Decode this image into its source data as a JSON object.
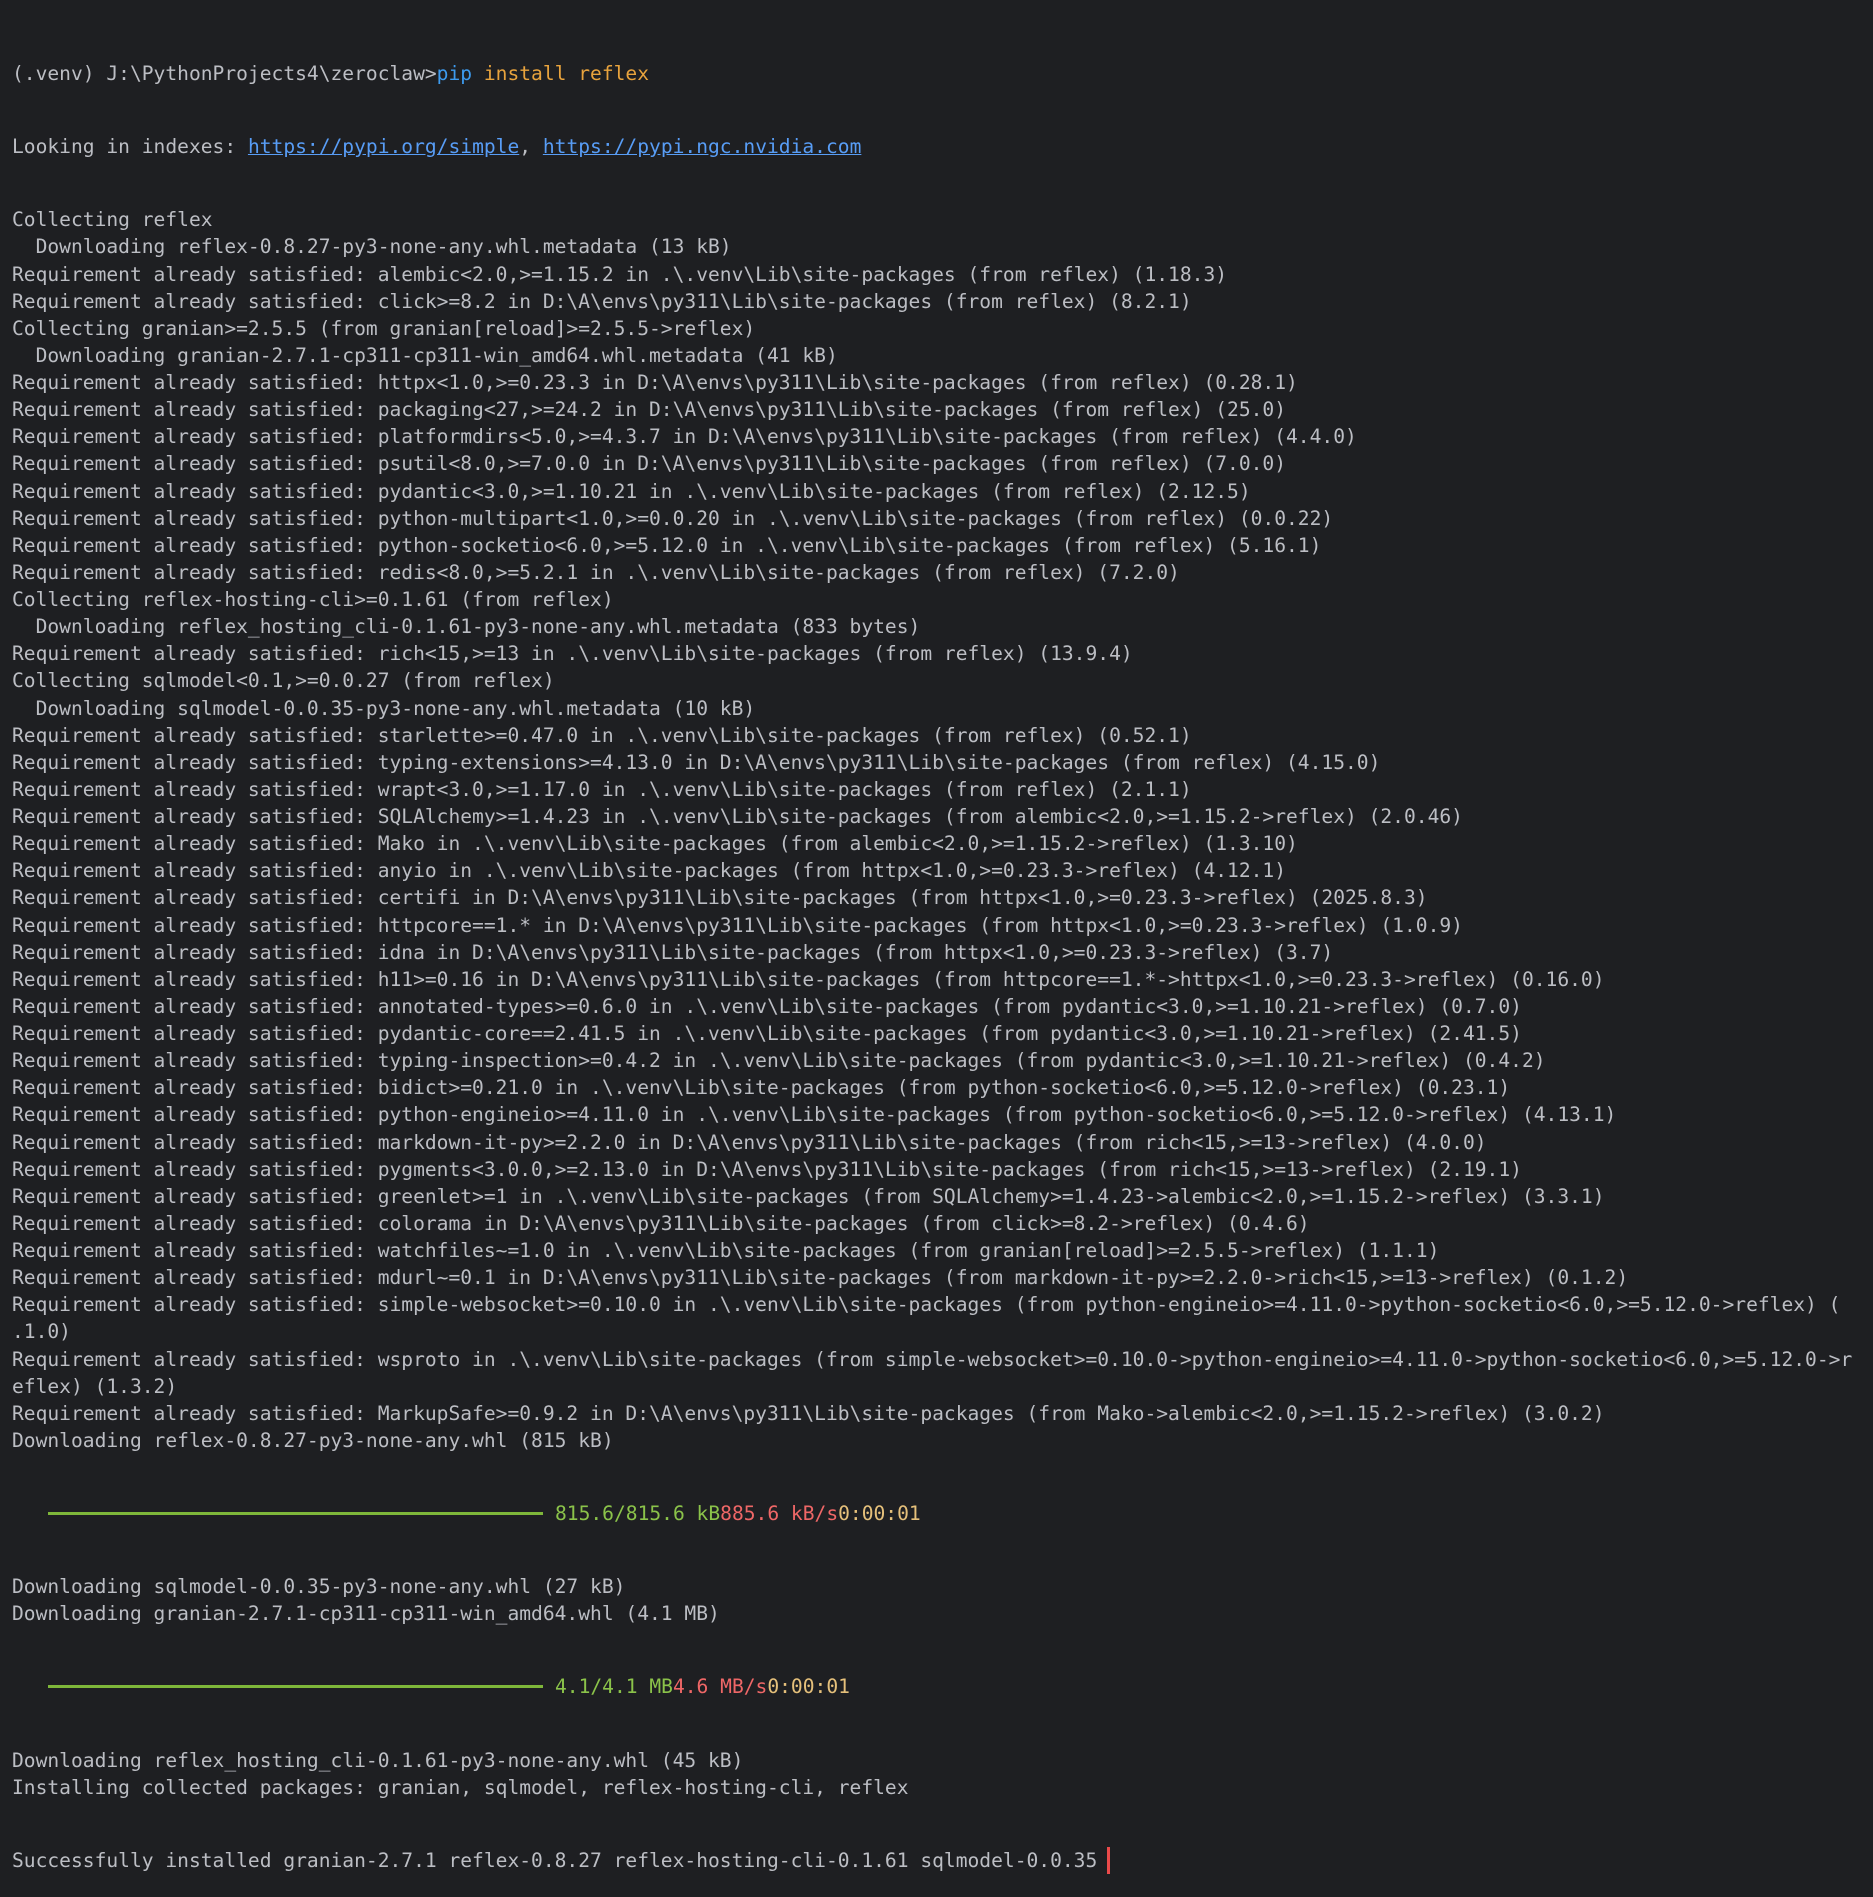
{
  "theme": {
    "background": "#1e1f22",
    "text": "#bcbec4",
    "command_keyword": "#3d9bef",
    "command_arg": "#e8a33d",
    "link": "#589df6",
    "progress_bar": "#7eb63a",
    "progress_size": "#8bc34a",
    "progress_speed": "#ef6767",
    "progress_eta": "#e5c07b",
    "highlight_border": "#ea4a4a"
  },
  "prompt": {
    "path": "(.venv) J:\\PythonProjects4\\zeroclaw>",
    "cmd": "pip",
    "args": " install reflex"
  },
  "indexes": {
    "label": "Looking in indexes: ",
    "link1": "https://pypi.org/simple",
    "sep": ", ",
    "link2": "https://pypi.ngc.nvidia.com"
  },
  "lines_a": [
    "Collecting reflex",
    "  Downloading reflex-0.8.27-py3-none-any.whl.metadata (13 kB)",
    "Requirement already satisfied: alembic<2.0,>=1.15.2 in .\\.venv\\Lib\\site-packages (from reflex) (1.18.3)",
    "Requirement already satisfied: click>=8.2 in D:\\A\\envs\\py311\\Lib\\site-packages (from reflex) (8.2.1)",
    "Collecting granian>=2.5.5 (from granian[reload]>=2.5.5->reflex)",
    "  Downloading granian-2.7.1-cp311-cp311-win_amd64.whl.metadata (41 kB)",
    "Requirement already satisfied: httpx<1.0,>=0.23.3 in D:\\A\\envs\\py311\\Lib\\site-packages (from reflex) (0.28.1)",
    "Requirement already satisfied: packaging<27,>=24.2 in D:\\A\\envs\\py311\\Lib\\site-packages (from reflex) (25.0)",
    "Requirement already satisfied: platformdirs<5.0,>=4.3.7 in D:\\A\\envs\\py311\\Lib\\site-packages (from reflex) (4.4.0)",
    "Requirement already satisfied: psutil<8.0,>=7.0.0 in D:\\A\\envs\\py311\\Lib\\site-packages (from reflex) (7.0.0)",
    "Requirement already satisfied: pydantic<3.0,>=1.10.21 in .\\.venv\\Lib\\site-packages (from reflex) (2.12.5)",
    "Requirement already satisfied: python-multipart<1.0,>=0.0.20 in .\\.venv\\Lib\\site-packages (from reflex) (0.0.22)",
    "Requirement already satisfied: python-socketio<6.0,>=5.12.0 in .\\.venv\\Lib\\site-packages (from reflex) (5.16.1)",
    "Requirement already satisfied: redis<8.0,>=5.2.1 in .\\.venv\\Lib\\site-packages (from reflex) (7.2.0)",
    "Collecting reflex-hosting-cli>=0.1.61 (from reflex)",
    "  Downloading reflex_hosting_cli-0.1.61-py3-none-any.whl.metadata (833 bytes)",
    "Requirement already satisfied: rich<15,>=13 in .\\.venv\\Lib\\site-packages (from reflex) (13.9.4)",
    "Collecting sqlmodel<0.1,>=0.0.27 (from reflex)",
    "  Downloading sqlmodel-0.0.35-py3-none-any.whl.metadata (10 kB)",
    "Requirement already satisfied: starlette>=0.47.0 in .\\.venv\\Lib\\site-packages (from reflex) (0.52.1)",
    "Requirement already satisfied: typing-extensions>=4.13.0 in D:\\A\\envs\\py311\\Lib\\site-packages (from reflex) (4.15.0)",
    "Requirement already satisfied: wrapt<3.0,>=1.17.0 in .\\.venv\\Lib\\site-packages (from reflex) (2.1.1)",
    "Requirement already satisfied: SQLAlchemy>=1.4.23 in .\\.venv\\Lib\\site-packages (from alembic<2.0,>=1.15.2->reflex) (2.0.46)",
    "Requirement already satisfied: Mako in .\\.venv\\Lib\\site-packages (from alembic<2.0,>=1.15.2->reflex) (1.3.10)",
    "Requirement already satisfied: anyio in .\\.venv\\Lib\\site-packages (from httpx<1.0,>=0.23.3->reflex) (4.12.1)",
    "Requirement already satisfied: certifi in D:\\A\\envs\\py311\\Lib\\site-packages (from httpx<1.0,>=0.23.3->reflex) (2025.8.3)",
    "Requirement already satisfied: httpcore==1.* in D:\\A\\envs\\py311\\Lib\\site-packages (from httpx<1.0,>=0.23.3->reflex) (1.0.9)",
    "Requirement already satisfied: idna in D:\\A\\envs\\py311\\Lib\\site-packages (from httpx<1.0,>=0.23.3->reflex) (3.7)",
    "Requirement already satisfied: h11>=0.16 in D:\\A\\envs\\py311\\Lib\\site-packages (from httpcore==1.*->httpx<1.0,>=0.23.3->reflex) (0.16.0)",
    "Requirement already satisfied: annotated-types>=0.6.0 in .\\.venv\\Lib\\site-packages (from pydantic<3.0,>=1.10.21->reflex) (0.7.0)",
    "Requirement already satisfied: pydantic-core==2.41.5 in .\\.venv\\Lib\\site-packages (from pydantic<3.0,>=1.10.21->reflex) (2.41.5)",
    "Requirement already satisfied: typing-inspection>=0.4.2 in .\\.venv\\Lib\\site-packages (from pydantic<3.0,>=1.10.21->reflex) (0.4.2)",
    "Requirement already satisfied: bidict>=0.21.0 in .\\.venv\\Lib\\site-packages (from python-socketio<6.0,>=5.12.0->reflex) (0.23.1)",
    "Requirement already satisfied: python-engineio>=4.11.0 in .\\.venv\\Lib\\site-packages (from python-socketio<6.0,>=5.12.0->reflex) (4.13.1)",
    "Requirement already satisfied: markdown-it-py>=2.2.0 in D:\\A\\envs\\py311\\Lib\\site-packages (from rich<15,>=13->reflex) (4.0.0)",
    "Requirement already satisfied: pygments<3.0.0,>=2.13.0 in D:\\A\\envs\\py311\\Lib\\site-packages (from rich<15,>=13->reflex) (2.19.1)",
    "Requirement already satisfied: greenlet>=1 in .\\.venv\\Lib\\site-packages (from SQLAlchemy>=1.4.23->alembic<2.0,>=1.15.2->reflex) (3.3.1)",
    "Requirement already satisfied: colorama in D:\\A\\envs\\py311\\Lib\\site-packages (from click>=8.2->reflex) (0.4.6)",
    "Requirement already satisfied: watchfiles~=1.0 in .\\.venv\\Lib\\site-packages (from granian[reload]>=2.5.5->reflex) (1.1.1)",
    "Requirement already satisfied: mdurl~=0.1 in D:\\A\\envs\\py311\\Lib\\site-packages (from markdown-it-py>=2.2.0->rich<15,>=13->reflex) (0.1.2)",
    "Requirement already satisfied: simple-websocket>=0.10.0 in .\\.venv\\Lib\\site-packages (from python-engineio>=4.11.0->python-socketio<6.0,>=5.12.0->reflex) (",
    ".1.0)",
    "Requirement already satisfied: wsproto in .\\.venv\\Lib\\site-packages (from simple-websocket>=0.10.0->python-engineio>=4.11.0->python-socketio<6.0,>=5.12.0->r",
    "eflex) (1.3.2)",
    "Requirement already satisfied: MarkupSafe>=0.9.2 in D:\\A\\envs\\py311\\Lib\\site-packages (from Mako->alembic<2.0,>=1.15.2->reflex) (3.0.2)",
    "Downloading reflex-0.8.27-py3-none-any.whl (815 kB)"
  ],
  "progress1": {
    "fraction": 1.0,
    "size": "815.6/815.6 kB",
    "speed": "885.6 kB/s",
    "eta": "0:00:01"
  },
  "lines_b": [
    "Downloading sqlmodel-0.0.35-py3-none-any.whl (27 kB)",
    "Downloading granian-2.7.1-cp311-cp311-win_amd64.whl (4.1 MB)"
  ],
  "progress2": {
    "fraction": 1.0,
    "size": "4.1/4.1 MB",
    "speed": "4.6 MB/s",
    "eta": "0:00:01"
  },
  "lines_c": [
    "Downloading reflex_hosting_cli-0.1.61-py3-none-any.whl (45 kB)",
    "Installing collected packages: granian, sqlmodel, reflex-hosting-cli, reflex"
  ],
  "success": "Successfully installed granian-2.7.1 reflex-0.8.27 reflex-hosting-cli-0.1.61 sqlmodel-0.0.35"
}
